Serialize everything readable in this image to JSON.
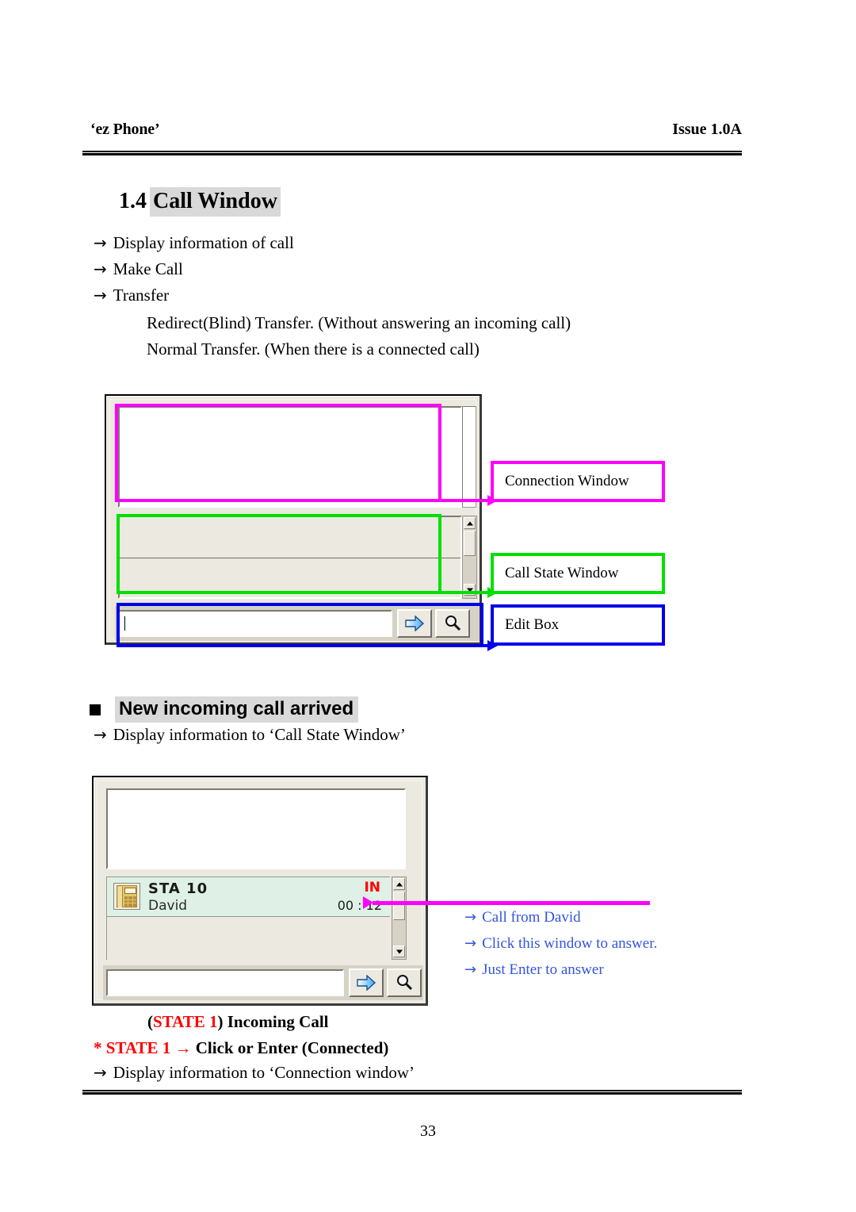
{
  "header": {
    "left": "‘ez Phone’",
    "right": "Issue 1.0A"
  },
  "title": {
    "number": "1.4",
    "text": "Call Window"
  },
  "intro_bullets": [
    "Display information of call",
    "Make Call",
    "Transfer"
  ],
  "transfer_details": [
    "Redirect(Blind) Transfer. (Without answering an incoming call)",
    "Normal Transfer. (When there is a connected call)"
  ],
  "figure1": {
    "callouts": [
      {
        "label": "Connection Window",
        "color": "#ff00ff"
      },
      {
        "label": "Call State Window",
        "color": "#00e000"
      },
      {
        "label": "Edit Box",
        "color": "#0000e6"
      }
    ],
    "edit_value": "",
    "buttons": [
      {
        "name": "dial-arrow",
        "glyph": "⇨"
      },
      {
        "name": "search",
        "glyph": "⌕"
      }
    ]
  },
  "section": {
    "heading": "New incoming call arrived",
    "bullet": "Display information to ‘Call State Window’"
  },
  "figure2": {
    "call": {
      "station": "STA 10",
      "name": "David",
      "direction": "IN",
      "direction_color": "#ff0000",
      "timer": "00 : 12",
      "row_color": "#dff0e6"
    },
    "edit_value": "",
    "notes": [
      "Call from David",
      "Click this window to answer.",
      "Just Enter to answer"
    ],
    "note_color": "#3355dd"
  },
  "state_lines": {
    "line1_open": "(",
    "line1_red": "STATE 1",
    "line1_close": ") Incoming Call",
    "line2_red": "* STATE 1 →",
    "line2_black": " Click or Enter (Connected)",
    "line3": "Display information to ‘Connection window’"
  },
  "footer": {
    "page_number": "33"
  },
  "arrow_glyph": "→"
}
